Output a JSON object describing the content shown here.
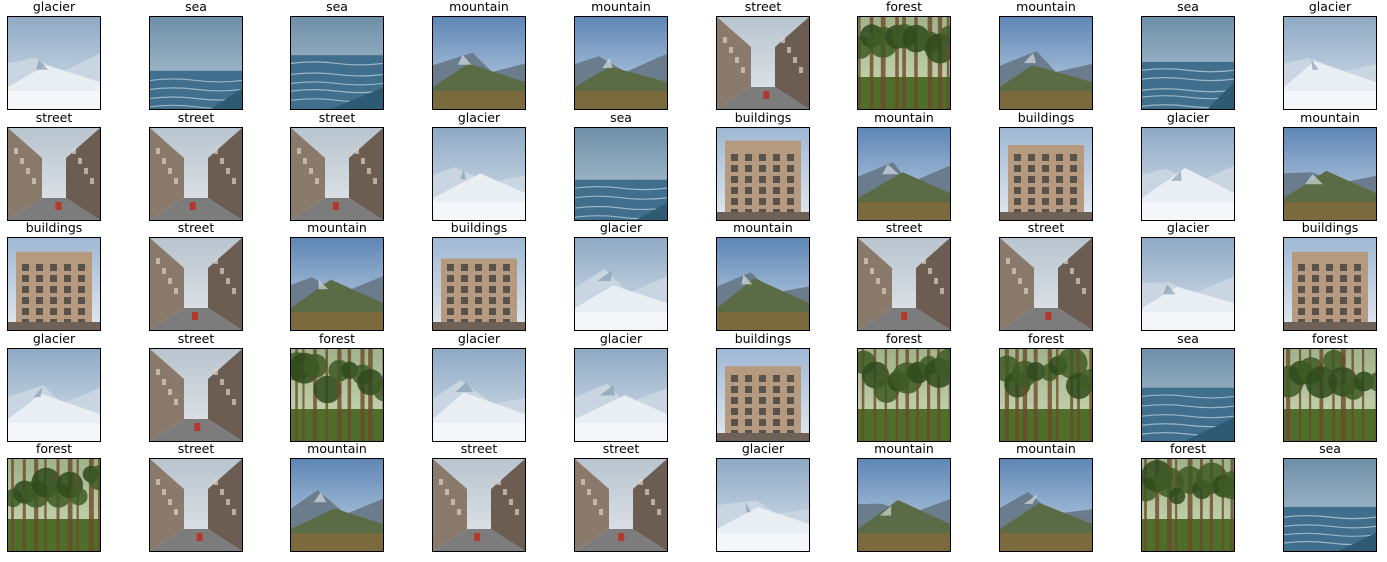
{
  "gallery": {
    "rows": [
      [
        "glacier",
        "sea",
        "sea",
        "mountain",
        "mountain",
        "street",
        "forest",
        "mountain",
        "sea",
        "glacier"
      ],
      [
        "street",
        "street",
        "street",
        "glacier",
        "sea",
        "buildings",
        "mountain",
        "buildings",
        "glacier",
        "mountain"
      ],
      [
        "buildings",
        "street",
        "mountain",
        "buildings",
        "glacier",
        "mountain",
        "street",
        "street",
        "glacier",
        "buildings"
      ],
      [
        "glacier",
        "street",
        "forest",
        "glacier",
        "glacier",
        "buildings",
        "forest",
        "forest",
        "sea",
        "forest"
      ],
      [
        "forest",
        "street",
        "mountain",
        "street",
        "street",
        "glacier",
        "mountain",
        "mountain",
        "forest",
        "sea"
      ]
    ]
  }
}
